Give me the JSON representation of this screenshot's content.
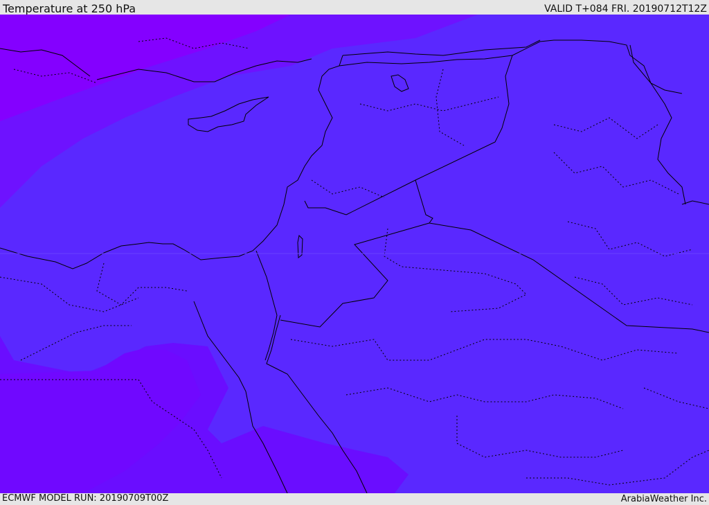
{
  "header": {
    "title": "Temperature at 250 hPa",
    "valid": "VALID T+084 FRI. 20190712T12Z"
  },
  "footer": {
    "model_run": "ECMWF MODEL RUN: 20190709T00Z",
    "credit": "ArabiaWeather Inc."
  },
  "colors": {
    "band_cold": "#8400ff",
    "band_mid": "#6a0dff",
    "band_main": "#5a28ff",
    "coastline": "#000000",
    "border": "#000000"
  }
}
